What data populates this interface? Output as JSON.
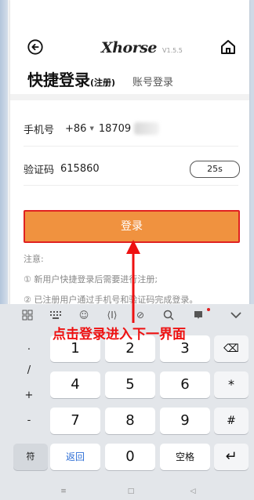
{
  "header": {
    "logo_text": "Xhorse",
    "version": "V1.5.5",
    "tab_quick_login": "快捷登录",
    "tab_quick_suffix": "(注册)",
    "tab_account_login": "账号登录"
  },
  "form": {
    "phone_label": "手机号",
    "country_code": "+86",
    "phone_value": "18709",
    "code_label": "验证码",
    "code_value": "615860",
    "timer": "25s",
    "login_button": "登录"
  },
  "notes": {
    "title": "注意:",
    "note1": "① 新用户快捷登录后需要进行注册;",
    "note2": "② 已注册用户通过手机号和验证码完成登录。"
  },
  "annotation": {
    "text": "点击登录进入下一界面",
    "color": "#ee1111"
  },
  "keyboard": {
    "toolbar_icons": [
      "grid-icon",
      "keyboard-icon",
      "emoji-icon",
      "cursor-icon",
      "link-icon",
      "search-icon",
      "notification-icon",
      "collapse-icon"
    ],
    "symbol_keys": [
      ".",
      "/",
      "+",
      "-"
    ],
    "digits": [
      "1",
      "2",
      "3",
      "4",
      "5",
      "6",
      "7",
      "8",
      "9",
      "0"
    ],
    "right_keys": [
      "⌫",
      "*",
      "#",
      "↵"
    ],
    "symbols_key": "符",
    "return_key": "返回",
    "space_key": "空格"
  },
  "colors": {
    "login_button": "#f0923f",
    "highlight_border": "#e02121",
    "return_text": "#2f6fd6"
  }
}
